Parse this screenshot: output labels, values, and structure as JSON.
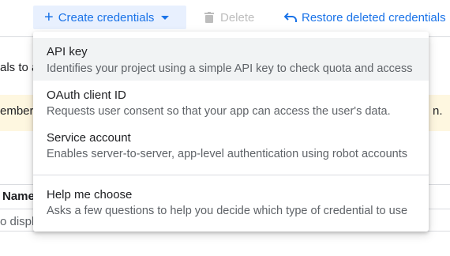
{
  "toolbar": {
    "create_label": "Create credentials",
    "delete_label": "Delete",
    "restore_label": "Restore deleted credentials"
  },
  "background": {
    "left_fragment_1": "als to a",
    "banner_left": "ember t",
    "banner_right": "n.",
    "table_header_name": "Name",
    "table_row_text": "o displ"
  },
  "menu": {
    "items": [
      {
        "title": "API key",
        "description": "Identifies your project using a simple API key to check quota and access"
      },
      {
        "title": "OAuth client ID",
        "description": "Requests user consent so that your app can access the user's data."
      },
      {
        "title": "Service account",
        "description": "Enables server-to-server, app-level authentication using robot accounts"
      },
      {
        "title": "Help me choose",
        "description": "Asks a few questions to help you decide which type of credential to use"
      }
    ]
  },
  "colors": {
    "accent": "#1a73e8",
    "button_bg": "#e8f0fe",
    "banner_bg": "#fef7e0",
    "disabled": "#bdbdbd"
  }
}
